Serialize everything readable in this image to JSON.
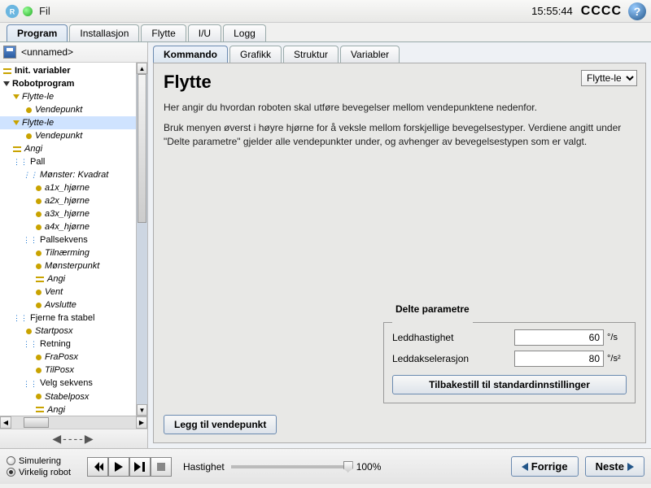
{
  "topbar": {
    "menu_fil": "Fil",
    "time": "15:55:44",
    "cccc": "CCCC",
    "help": "?"
  },
  "maintabs": [
    {
      "label": "Program",
      "active": true
    },
    {
      "label": "Installasjon"
    },
    {
      "label": "Flytte"
    },
    {
      "label": "I/U"
    },
    {
      "label": "Logg"
    }
  ],
  "file": {
    "name": "<unnamed>"
  },
  "tree": {
    "init": "Init. variabler",
    "robot": "Robotprogram",
    "move1": "Flytte-le",
    "wp1": "Vendepunkt",
    "move2": "Flytte-le",
    "wp2": "Vendepunkt",
    "angi": "Angi",
    "pall": "Pall",
    "pattern": "Mønster: Kvadrat",
    "a1": "a1x_hjørne",
    "a2": "a2x_hjørne",
    "a3": "a3x_hjørne",
    "a4": "a4x_hjørne",
    "pallseq": "Pallsekvens",
    "approach": "Tilnærming",
    "patpt": "Mønsterpunkt",
    "angi2": "Angi",
    "vent": "Vent",
    "exit": "Avslutte",
    "remove": "Fjerne fra stabel",
    "startpos": "Startposx",
    "direction": "Retning",
    "frapos": "FraPosx",
    "tilpos": "TilPosx",
    "velgseq": "Velg sekvens",
    "stabelpos": "Stabelposx",
    "angi3": "Angi"
  },
  "subtabs": [
    {
      "label": "Kommando",
      "active": true
    },
    {
      "label": "Grafikk"
    },
    {
      "label": "Struktur"
    },
    {
      "label": "Variabler"
    }
  ],
  "command": {
    "title": "Flytte",
    "movetype": "Flytte-le",
    "desc1": "Her angir du hvordan roboten skal utføre bevegelser mellom vendepunktene nedenfor.",
    "desc2": "Bruk menyen øverst i høyre hjørne for å veksle mellom forskjellige bevegelsestyper. Verdiene angitt under \"Delte parametre\" gjelder alle vendepunkter under, og avhenger av bevegelsestypen som er valgt.",
    "params_legend": "Delte parametre",
    "speed_label": "Leddhastighet",
    "speed_value": "60",
    "speed_unit": "°/s",
    "accel_label": "Leddakselerasjon",
    "accel_value": "80",
    "accel_unit": "°/s²",
    "reset": "Tilbakestill til standardinnstillinger",
    "add_wp": "Legg til vendepunkt"
  },
  "bottom": {
    "sim": "Simulering",
    "real": "Virkelig robot",
    "speed_label": "Hastighet",
    "speed_pct": "100%",
    "prev": "Forrige",
    "next": "Neste"
  },
  "nav_arrows": "◀----▶"
}
